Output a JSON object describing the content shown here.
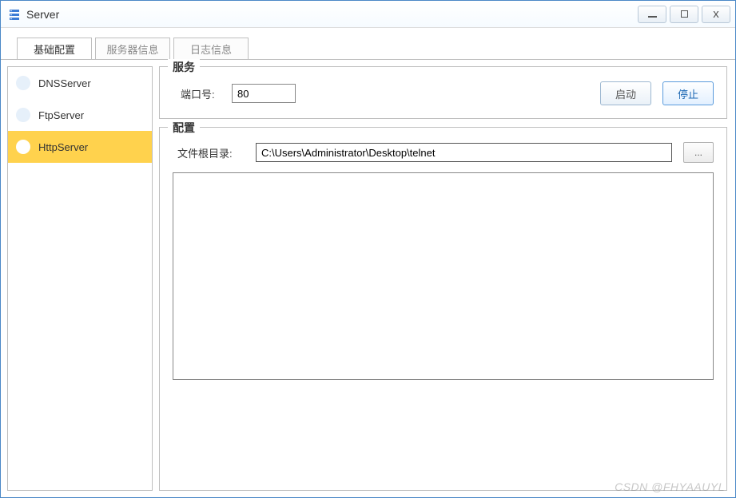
{
  "window": {
    "title": "Server"
  },
  "tabs": {
    "basic": "基础配置",
    "serverInfo": "服务器信息",
    "logInfo": "日志信息"
  },
  "sidebar": {
    "items": [
      {
        "label": "DNSServer"
      },
      {
        "label": "FtpServer"
      },
      {
        "label": "HttpServer"
      }
    ]
  },
  "service": {
    "legend": "服务",
    "portLabel": "端口号:",
    "portValue": "80",
    "startLabel": "启动",
    "stopLabel": "停止"
  },
  "config": {
    "legend": "配置",
    "rootLabel": "文件根目录:",
    "rootValue": "C:\\Users\\Administrator\\Desktop\\telnet",
    "browseLabel": "...",
    "textareaValue": ""
  },
  "watermark": "CSDN @FHYAAUYL"
}
